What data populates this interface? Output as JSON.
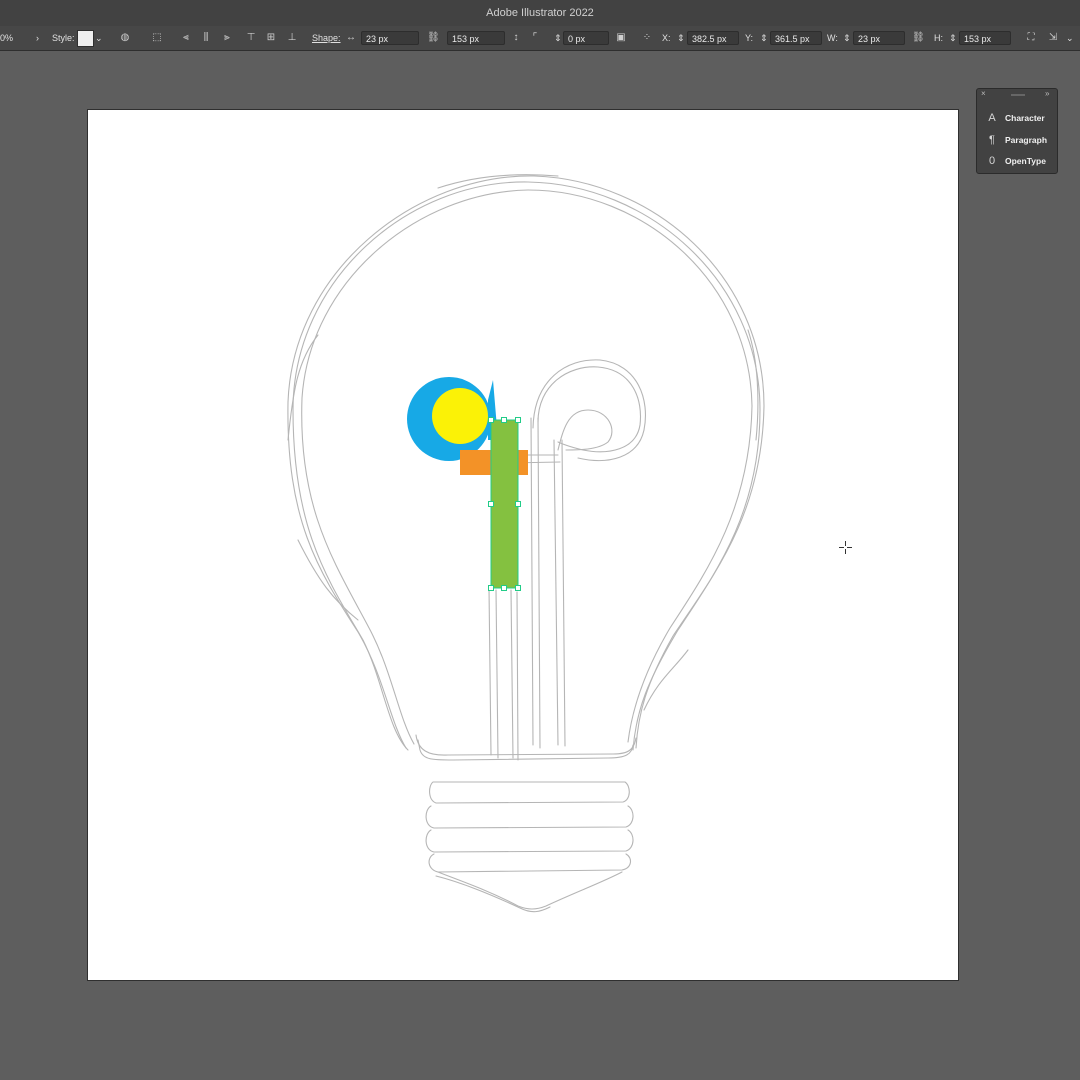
{
  "window": {
    "title": "Adobe Illustrator 2022"
  },
  "control_bar": {
    "opacity_value": "0%",
    "style_label": "Style:",
    "shape_label": "Shape:",
    "shape_width": "23 px",
    "shape_height": "153 px",
    "corner_radius": "0 px",
    "x_label": "X:",
    "x_value": "382.5 px",
    "y_label": "Y:",
    "y_value": "361.5 px",
    "w_label": "W:",
    "w_value": "23 px",
    "h_label": "H:",
    "h_value": "153 px"
  },
  "type_panel": {
    "items": [
      {
        "label": "Character",
        "icon": "character-icon"
      },
      {
        "label": "Paragraph",
        "icon": "paragraph-icon"
      },
      {
        "label": "OpenType",
        "icon": "opentype-icon"
      }
    ]
  },
  "artwork": {
    "colors": {
      "blue": "#17a9e6",
      "yellow": "#fbf206",
      "orange": "#f39227",
      "green": "#84c140",
      "selection": "#22cc88",
      "sketch": "#a9a9a9"
    }
  }
}
